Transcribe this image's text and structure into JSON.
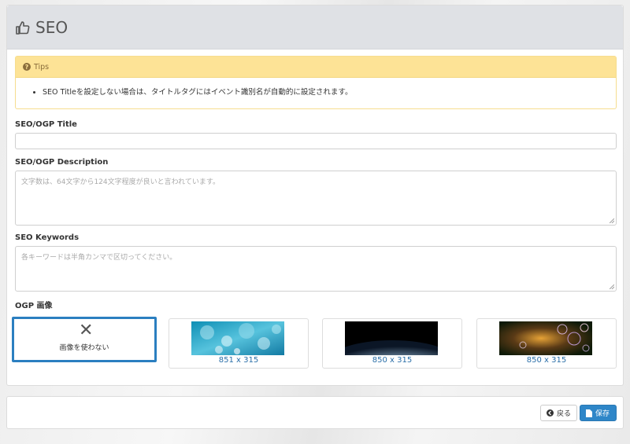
{
  "header": {
    "title": "SEO",
    "icon": "thumbs-up-icon"
  },
  "tips": {
    "heading": "Tips",
    "items": [
      "SEO Titleを設定しない場合は、タイトルタグにはイベント識別名が自動的に設定されます。"
    ]
  },
  "fields": {
    "title": {
      "label": "SEO/OGP Title",
      "value": ""
    },
    "description": {
      "label": "SEO/OGP Description",
      "placeholder": "文字数は、64文字から124文字程度が良いと言われています。"
    },
    "keywords": {
      "label": "SEO Keywords",
      "placeholder": "各キーワードは半角カンマで区切ってください。"
    }
  },
  "ogp": {
    "label": "OGP 画像",
    "none_label": "画像を使わない",
    "images": [
      {
        "size": "851 x 315"
      },
      {
        "size": "850 x 315"
      },
      {
        "size": "850 x 315"
      }
    ]
  },
  "actions": {
    "back_label": "戻る",
    "save_label": "保存"
  },
  "colors": {
    "accent": "#2e86c8",
    "tips_bg": "#fde396",
    "header_bg": "#dfe1e5"
  }
}
